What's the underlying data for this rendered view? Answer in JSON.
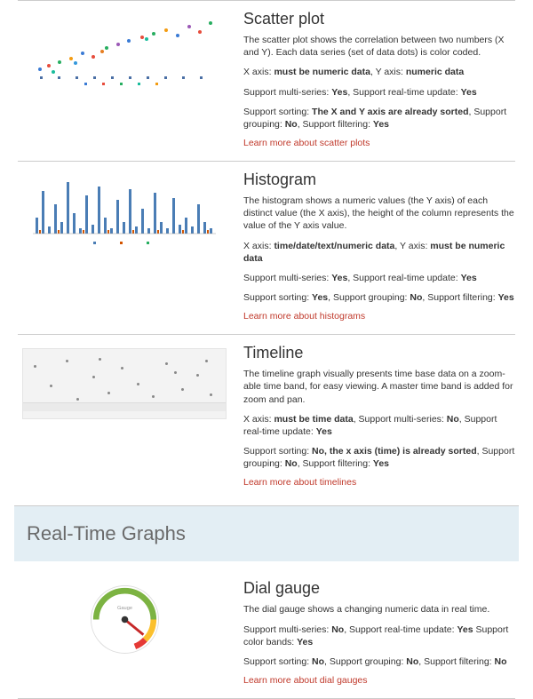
{
  "items": {
    "scatter": {
      "title": "Scatter plot",
      "desc": "The scatter plot shows the correlation between two numbers (X and Y). Each data series (set of data dots) is color coded.",
      "axes_prefix": "X axis: ",
      "axes_x": "must be numeric data",
      "axes_mid": ", Y axis: ",
      "axes_y": "numeric data",
      "multi_prefix": "Support multi-series: ",
      "multi": "Yes",
      "rt_mid": ", Support real-time update: ",
      "rt": "Yes",
      "sort_prefix": "Support sorting: ",
      "sort": "The X and Y axis are already sorted",
      "group_mid": ", Support grouping: ",
      "group": "No",
      "filter_mid": ", Support filtering: ",
      "filter": "Yes",
      "link": "Learn more about scatter plots"
    },
    "histogram": {
      "title": "Histogram",
      "desc": "The histogram shows a numeric values (the Y axis) of each distinct value (the X axis), the height of the column represents the value of the Y axis value.",
      "axes_prefix": "X axis: ",
      "axes_x": "time/date/text/numeric data",
      "axes_mid": ", Y axis: ",
      "axes_y": "must be numeric data",
      "multi_prefix": "Support multi-series: ",
      "multi": "Yes",
      "rt_mid": ", Support real-time update: ",
      "rt": "Yes",
      "sort_prefix": "Support sorting: ",
      "sort": "Yes",
      "group_mid": ", Support grouping: ",
      "group": "No",
      "filter_mid": ", Support filtering: ",
      "filter": "Yes",
      "link": "Learn more about histograms"
    },
    "timeline": {
      "title": "Timeline",
      "desc": "The timeline graph visually presents time base data on a zoom-able time band, for easy viewing. A master time band is added for zoom and pan.",
      "axes_prefix": "X axis: ",
      "axes_x": "must be time data",
      "multi_mid": ", Support multi-series: ",
      "multi": "No",
      "rt_mid": ", Support real-time update: ",
      "rt": "Yes",
      "sort_prefix": "Support sorting: ",
      "sort": "No, the x axis (time) is already sorted",
      "group_mid": ", Support grouping: ",
      "group": "No",
      "filter_mid": ", Support filtering: ",
      "filter": "Yes",
      "link": "Learn more about timelines"
    },
    "gauge": {
      "title": "Dial gauge",
      "desc": "The dial gauge shows a changing numeric data in real time.",
      "multi_prefix": "Support multi-series: ",
      "multi": "No",
      "rt_mid": ", Support real-time update: ",
      "rt": "Yes",
      "cb_mid": " Support color bands: ",
      "cb": "Yes",
      "sort_prefix": "Support sorting: ",
      "sort": "No",
      "group_mid": ", Support grouping: ",
      "group": "No",
      "filter_mid": ", Support filtering: ",
      "filter": "No",
      "link": "Learn more about dial gauges"
    }
  },
  "section": {
    "realtime": "Real-Time Graphs"
  }
}
